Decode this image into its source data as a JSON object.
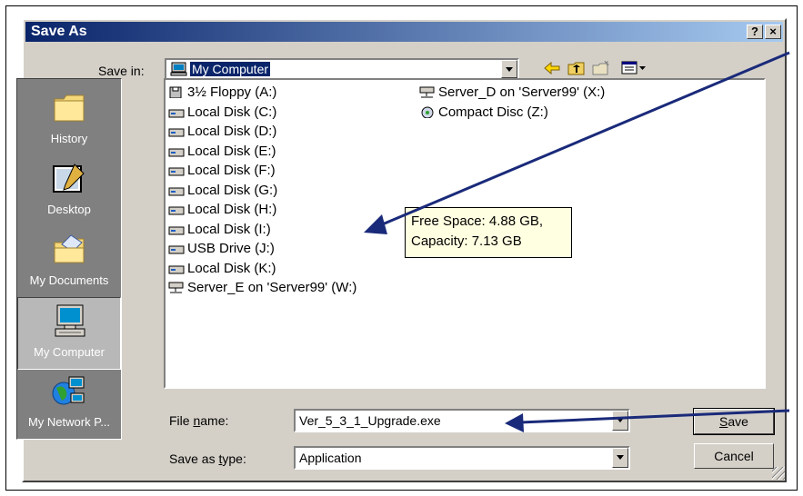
{
  "dialog": {
    "title": "Save As",
    "help_button": "?",
    "close_button": "×"
  },
  "save_in": {
    "label": "Save in:",
    "value": "My Computer"
  },
  "places": [
    {
      "label": "History",
      "icon": "history-icon"
    },
    {
      "label": "Desktop",
      "icon": "desktop-icon"
    },
    {
      "label": "My Documents",
      "icon": "my-documents-icon"
    },
    {
      "label": "My Computer",
      "icon": "my-computer-icon"
    },
    {
      "label": "My Network P...",
      "icon": "my-network-places-icon"
    }
  ],
  "files_col1": [
    {
      "label": "3½ Floppy (A:)",
      "icon": "floppy-drive-icon"
    },
    {
      "label": "Local Disk (C:)",
      "icon": "local-disk-icon"
    },
    {
      "label": "Local Disk (D:)",
      "icon": "local-disk-icon"
    },
    {
      "label": "Local Disk (E:)",
      "icon": "local-disk-icon"
    },
    {
      "label": "Local Disk (F:)",
      "icon": "local-disk-icon"
    },
    {
      "label": "Local Disk (G:)",
      "icon": "local-disk-icon"
    },
    {
      "label": "Local Disk (H:)",
      "icon": "local-disk-icon"
    },
    {
      "label": "Local Disk (I:)",
      "icon": "local-disk-icon"
    },
    {
      "label": "USB Drive (J:)",
      "icon": "usb-drive-icon"
    },
    {
      "label": "Local Disk (K:)",
      "icon": "local-disk-icon"
    },
    {
      "label": "Server_E on 'Server99' (W:)",
      "icon": "network-drive-icon"
    }
  ],
  "files_col2": [
    {
      "label": "Server_D on 'Server99' (X:)",
      "icon": "network-drive-icon"
    },
    {
      "label": "Compact Disc (Z:)",
      "icon": "cd-drive-icon"
    }
  ],
  "tooltip": {
    "line1": "Free Space: 4.88 GB,",
    "line2": "Capacity: 7.13 GB"
  },
  "file_name": {
    "label": "File name:",
    "value": "Ver_5_3_1_Upgrade.exe"
  },
  "save_as_type": {
    "label": "Save as type:",
    "value": "Application"
  },
  "buttons": {
    "save": "Save",
    "cancel": "Cancel"
  },
  "colors": {
    "titlebar_start": "#0a246a",
    "titlebar_end": "#a6caf0",
    "arrow": "#1a2a7a",
    "tooltip_bg": "#ffffe1"
  }
}
